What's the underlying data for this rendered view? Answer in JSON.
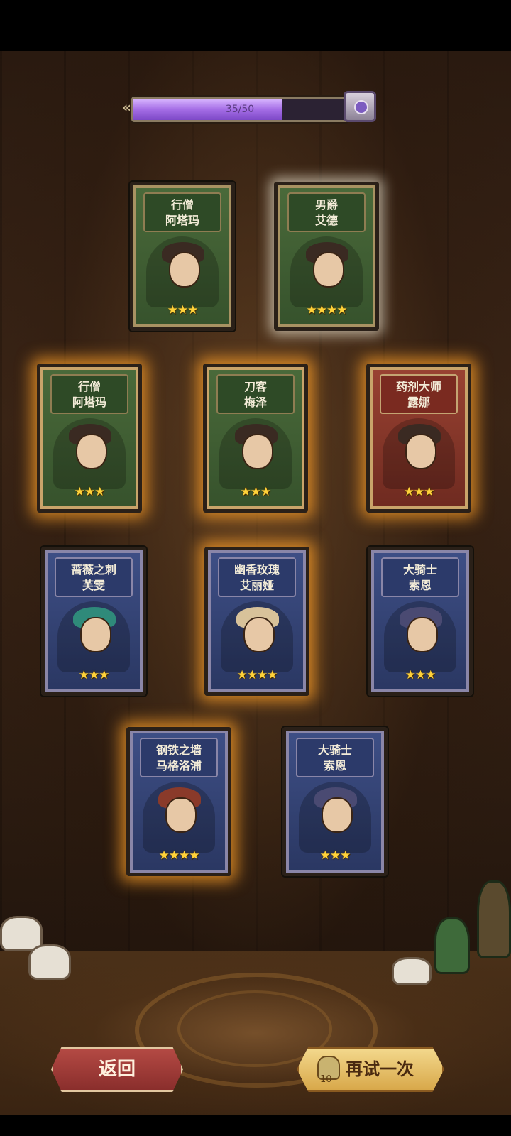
{
  "progress": {
    "text": "35/50",
    "value": 35,
    "max": 50
  },
  "cards": [
    {
      "id": "r1c1",
      "line1": "行僧",
      "line2": "阿塔玛",
      "stars": "★★★",
      "frame": "green"
    },
    {
      "id": "r1c2",
      "line1": "男爵",
      "line2": "艾德",
      "stars": "★★★★",
      "frame": "green"
    },
    {
      "id": "r2c1",
      "line1": "行僧",
      "line2": "阿塔玛",
      "stars": "★★★",
      "frame": "green"
    },
    {
      "id": "r2c2",
      "line1": "刀客",
      "line2": "梅泽",
      "stars": "★★★",
      "frame": "green"
    },
    {
      "id": "r2c3",
      "line1": "药剂大师",
      "line2": "露娜",
      "stars": "★★★",
      "frame": "red"
    },
    {
      "id": "r3c1",
      "line1": "蔷薇之刺",
      "line2": "芙雯",
      "stars": "★★★",
      "frame": "blue"
    },
    {
      "id": "r3c2",
      "line1": "幽香玫瑰",
      "line2": "艾丽娅",
      "stars": "★★★★",
      "frame": "blue"
    },
    {
      "id": "r3c3",
      "line1": "大骑士",
      "line2": "索恩",
      "stars": "★★★",
      "frame": "blue"
    },
    {
      "id": "r4c1",
      "line1": "钢铁之墙",
      "line2": "马格洛浦",
      "stars": "★★★★",
      "frame": "blue"
    },
    {
      "id": "r4c2",
      "line1": "大骑士",
      "line2": "索恩",
      "stars": "★★★",
      "frame": "blue"
    }
  ],
  "buttons": {
    "back": "返回",
    "retry": "再试一次",
    "retry_count": "10"
  },
  "icons": {
    "progress_arrows": "double-chevron-left-icon",
    "chest": "treasure-chest-icon",
    "retry_cost": "key-icon"
  },
  "colors": {
    "progress_fill": "#a56ee6",
    "star": "#ffd23a",
    "glow": "#ffa028",
    "back_button": "#a03c38",
    "retry_button": "#e8c46a"
  }
}
